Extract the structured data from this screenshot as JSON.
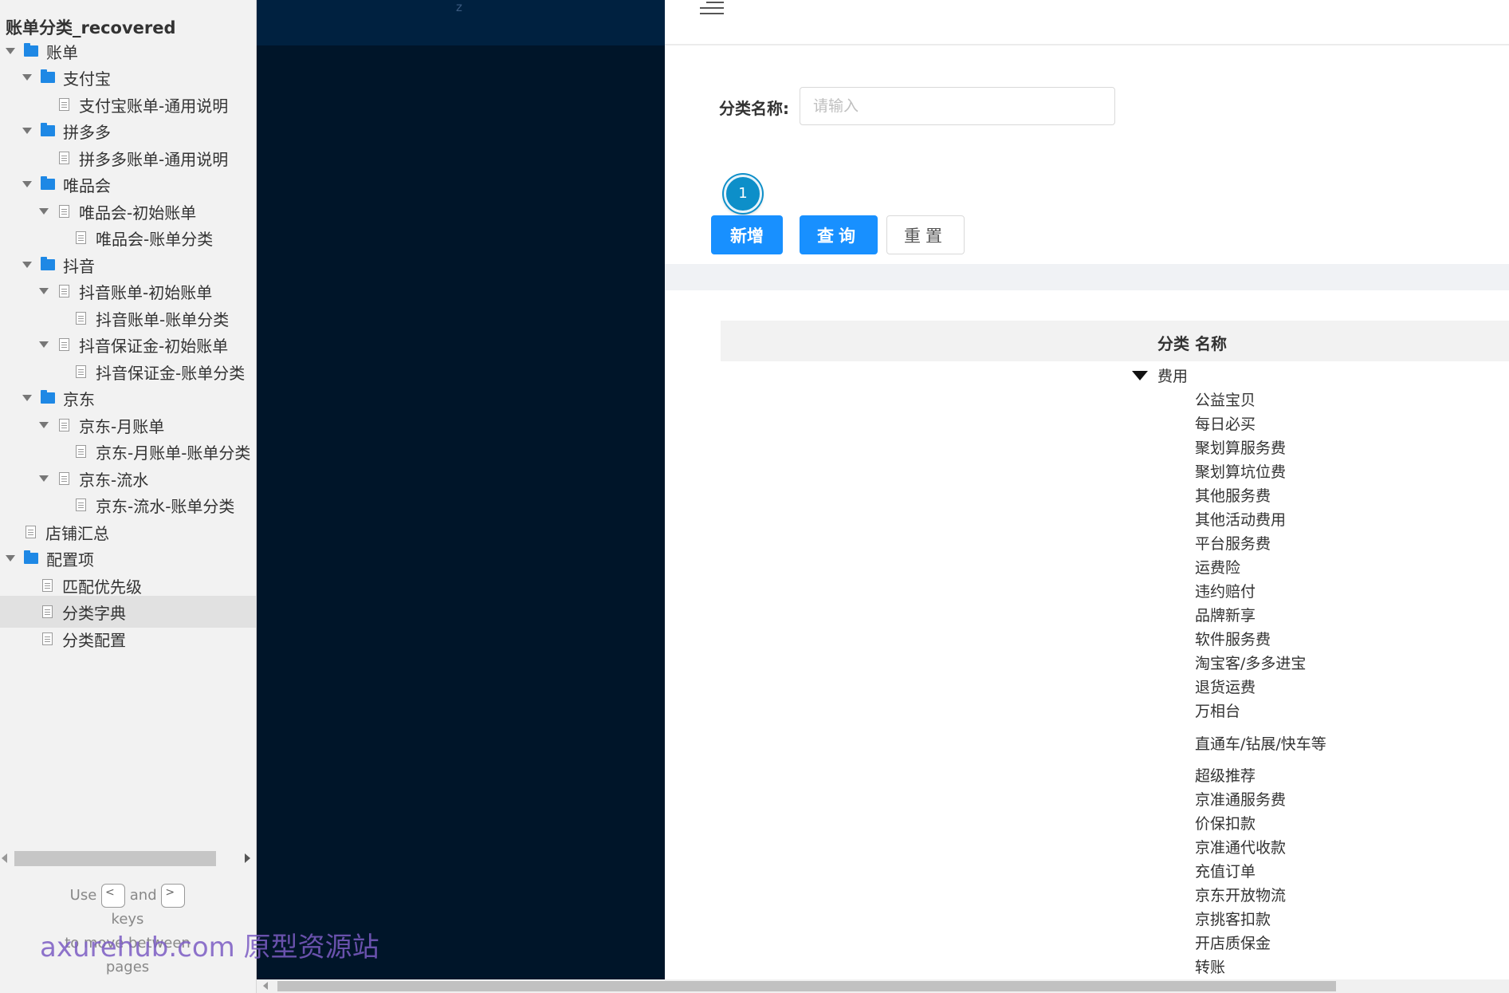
{
  "sitemap": {
    "title": "账单分类_recovered",
    "items": [
      {
        "label": "账单",
        "type": "folder",
        "level": 0,
        "expanded": true
      },
      {
        "label": "支付宝",
        "type": "folder",
        "level": 1,
        "expanded": true
      },
      {
        "label": "支付宝账单-通用说明",
        "type": "page",
        "level": 2,
        "expanded": false
      },
      {
        "label": "拼多多",
        "type": "folder",
        "level": 1,
        "expanded": true
      },
      {
        "label": "拼多多账单-通用说明",
        "type": "page",
        "level": 2,
        "expanded": false
      },
      {
        "label": "唯品会",
        "type": "folder",
        "level": 1,
        "expanded": true
      },
      {
        "label": "唯品会-初始账单",
        "type": "page",
        "level": 2,
        "expanded": true
      },
      {
        "label": "唯品会-账单分类",
        "type": "page",
        "level": 3,
        "expanded": false
      },
      {
        "label": "抖音",
        "type": "folder",
        "level": 1,
        "expanded": true
      },
      {
        "label": "抖音账单-初始账单",
        "type": "page",
        "level": 2,
        "expanded": true
      },
      {
        "label": "抖音账单-账单分类",
        "type": "page",
        "level": 3,
        "expanded": false
      },
      {
        "label": "抖音保证金-初始账单",
        "type": "page",
        "level": 2,
        "expanded": true
      },
      {
        "label": "抖音保证金-账单分类",
        "type": "page",
        "level": 3,
        "expanded": false
      },
      {
        "label": "京东",
        "type": "folder",
        "level": 1,
        "expanded": true
      },
      {
        "label": "京东-月账单",
        "type": "page",
        "level": 2,
        "expanded": true
      },
      {
        "label": "京东-月账单-账单分类",
        "type": "page",
        "level": 3,
        "expanded": false
      },
      {
        "label": "京东-流水",
        "type": "page",
        "level": 2,
        "expanded": true
      },
      {
        "label": "京东-流水-账单分类",
        "type": "page",
        "level": 3,
        "expanded": false
      },
      {
        "label": "店铺汇总",
        "type": "page",
        "level": 0,
        "expanded": false
      },
      {
        "label": "配置项",
        "type": "folder",
        "level": 0,
        "expanded": true
      },
      {
        "label": "匹配优先级",
        "type": "page",
        "level": 1,
        "expanded": false
      },
      {
        "label": "分类字典",
        "type": "page",
        "level": 1,
        "expanded": false,
        "selected": true
      },
      {
        "label": "分类配置",
        "type": "page",
        "level": 1,
        "expanded": false
      }
    ],
    "nav_hint": {
      "use": "Use",
      "key_prev": "<",
      "and": "and",
      "key_next": ">",
      "keys": "keys",
      "rest": "to move between pages"
    }
  },
  "dark_header": {
    "text": "z"
  },
  "search": {
    "label": "分类名称:",
    "placeholder": "请输入"
  },
  "badge": {
    "number": "1"
  },
  "buttons": {
    "add": "新增",
    "query": "查询",
    "reset": "重置"
  },
  "table": {
    "header": "分类 名称",
    "root": "费用",
    "children": [
      "公益宝贝",
      "每日必买",
      "聚划算服务费",
      "聚划算坑位费",
      "其他服务费",
      "其他活动费用",
      "平台服务费",
      "运费险",
      "违约赔付",
      "品牌新享",
      "软件服务费",
      "淘宝客/多多进宝",
      "退货运费",
      "万相台",
      "直通车/钻展/快车等",
      "超级推荐",
      "京准通服务费",
      "价保扣款",
      "京准通代收款",
      "充值订单",
      "京东开放物流",
      "京挑客扣款",
      "开店质保金",
      "转账"
    ]
  },
  "watermark": "axurehub.com 原型资源站"
}
